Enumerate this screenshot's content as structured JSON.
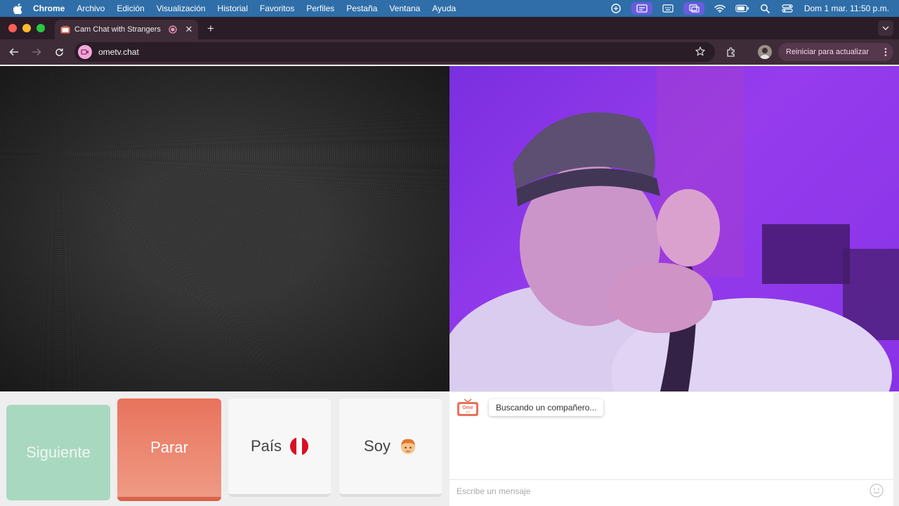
{
  "menubar": {
    "app": "Chrome",
    "items": [
      "Archivo",
      "Edición",
      "Visualización",
      "Historial",
      "Favoritos",
      "Perfiles",
      "Pestaña",
      "Ventana",
      "Ayuda"
    ],
    "clock": "Dom 1 mar.  11:50 p.m.",
    "status_icons": [
      "cloud-sync-icon",
      "screen-share-icon",
      "keyboard-brightness-icon",
      "screen-mirror-icon",
      "wifi-icon",
      "battery-icon",
      "spotlight-search-icon",
      "control-center-icon"
    ]
  },
  "browser": {
    "tab_title": "Cam Chat with Strangers",
    "tab_close": "✕",
    "new_tab": "+",
    "url": "ometv.chat",
    "update_label": "Reiniciar para actualizar"
  },
  "controls": {
    "next_label": "Siguiente",
    "stop_label": "Parar",
    "country_label": "País",
    "country_flag": "Peru",
    "gender_label": "Soy",
    "gender_emoji": "boy"
  },
  "chat": {
    "logo_text": "Ome",
    "logo_subtext": "TV",
    "status_message": "Buscando un compañero...",
    "input_placeholder": "Escribe un mensaje"
  },
  "colors": {
    "menubar": "#2f6ea8",
    "chrome_frame": "#2b1d28",
    "chrome_toolbar": "#3f2c39",
    "next_button": "#a9d8c1",
    "stop_button": "#e8735c",
    "webcam_tint": "#8a33e8"
  }
}
